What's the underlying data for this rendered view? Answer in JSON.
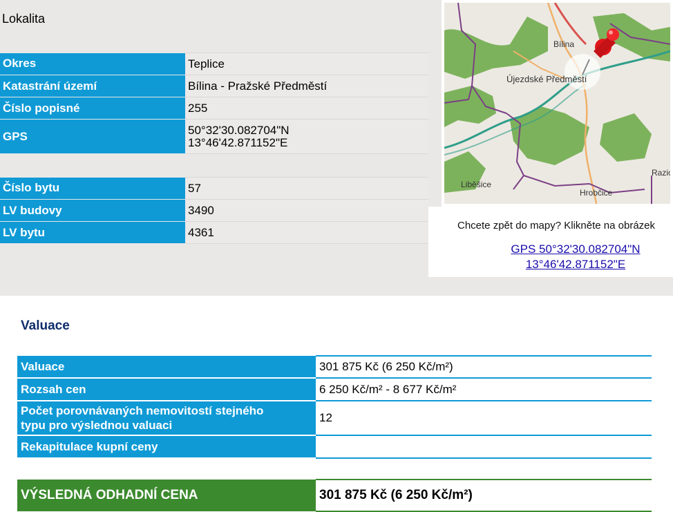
{
  "lokalita": {
    "title": "Lokalita",
    "rows_a": [
      {
        "label": "Okres",
        "value": "Teplice"
      },
      {
        "label": "Katastrání území",
        "value": "Bílina - Pražské Předměstí"
      },
      {
        "label": "Číslo popisné",
        "value": "255"
      },
      {
        "label": "GPS",
        "value_line1": "50°32'30.082704\"N",
        "value_line2": "13°46'42.871152\"E"
      }
    ],
    "rows_b": [
      {
        "label": "Číslo bytu",
        "value": "57"
      },
      {
        "label": "LV budovy",
        "value": "3490"
      },
      {
        "label": "LV bytu",
        "value": "4361"
      }
    ]
  },
  "map": {
    "place_labels": [
      "Bílina",
      "Újezdské Předměstí",
      "Liběšice",
      "Hrobčice",
      "Razic"
    ],
    "hint": "Chcete zpět do mapy? Klikněte na obrázek",
    "gps_link_line1": "GPS 50°32'30.082704\"N",
    "gps_link_line2": "13°46'42.871152\"E",
    "pin_icon": "pushpin-icon",
    "colors": {
      "forest": "#5ea03c",
      "border": "#7b3f86",
      "river": "#2f9e8a",
      "road": "#f0b06a",
      "highway": "#d9534f"
    }
  },
  "valuace": {
    "title": "Valuace",
    "rows": [
      {
        "label": "Valuace",
        "value": "301 875 Kč (6 250 Kč/m²)"
      },
      {
        "label": "Rozsah cen",
        "value": "6 250 Kč/m² - 8 677 Kč/m²"
      },
      {
        "label_line1": "Počet porovnávaných nemovitostí stejného",
        "label_line2": "typu pro výslednou valuaci",
        "value": "12"
      },
      {
        "label": "Rekapitulace kupní ceny",
        "value": ""
      }
    ],
    "final_label": "VÝSLEDNÁ ODHADNÍ CENA",
    "final_value": "301 875 Kč (6 250 Kč/m²)"
  },
  "colors": {
    "label_blue": "#0f9ad6",
    "final_green": "#3c8a2e",
    "title_navy": "#0f2d6b",
    "link": "#1a0dab",
    "top_bg": "#e9e8e7"
  }
}
